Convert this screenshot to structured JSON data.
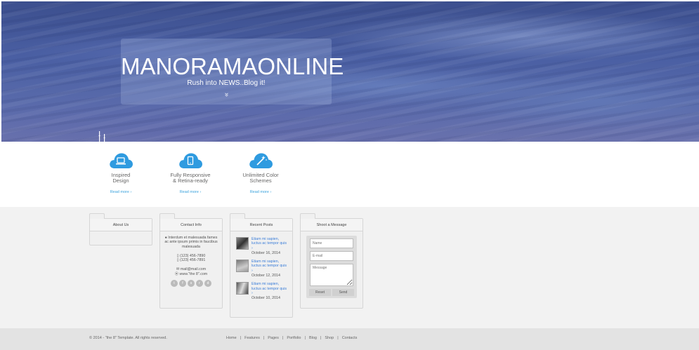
{
  "hero": {
    "title": "MANORAMAONLINE",
    "subtitle": "Rush into NEWS..Blog it!",
    "chevron": "»"
  },
  "features": [
    {
      "title_line1": "Inspired",
      "title_line2": "Design",
      "link": "Read more ›",
      "icon": "laptop-icon"
    },
    {
      "title_line1": "Fully Responsive",
      "title_line2": "& Retina-ready",
      "link": "Read more ›",
      "icon": "tablet-icon"
    },
    {
      "title_line1": "Unlimited Color",
      "title_line2": "Schemes",
      "link": "Read more ›",
      "icon": "magic-wand-icon"
    }
  ],
  "accent_color": "#3ba3dd",
  "widgets": {
    "about": {
      "title": "About Us"
    },
    "contact": {
      "title": "Contact Info",
      "address": "Interdum et malesuada fames ac ante ipsum primis in faucibus malesuada",
      "phone1": "(123) 456-7890",
      "phone2": "(123) 456-7891",
      "email": "mail@mail.com",
      "website": "www.\"the 8\".com",
      "social": [
        "twitter-icon",
        "facebook-icon",
        "skype-icon",
        "rss-icon",
        "dribbble-icon"
      ]
    },
    "recent_posts": {
      "title": "Recent Posts",
      "posts": [
        {
          "text": "Etiam mi sapien, luctus ac tempor quis ›",
          "date": "October 16, 2014"
        },
        {
          "text": "Etiam mi sapien, luctus ac tempor quis ›",
          "date": "October 12, 2014"
        },
        {
          "text": "Etiam mi sapien, luctus ac tempor quis ›",
          "date": "October 10, 2014"
        }
      ]
    },
    "message": {
      "title": "Shoot a Message",
      "name_placeholder": "Name",
      "email_placeholder": "E-mail",
      "message_placeholder": "Message",
      "reset_label": "Reset",
      "send_label": "Send"
    }
  },
  "footer": {
    "copyright": "© 2014 - \"the 8\" Template. All rights reserved.",
    "nav": [
      "Home",
      "Features",
      "Pages",
      "Portfolio",
      "Blog",
      "Shop",
      "Contacts"
    ]
  }
}
